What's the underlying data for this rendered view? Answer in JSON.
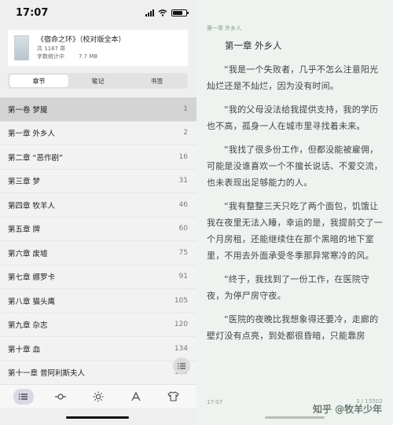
{
  "status_bar": {
    "time": "17:07"
  },
  "book": {
    "title": "《宿命之环》（校对版全本）",
    "chapters_count": "共 1187 章",
    "stats_label": "字数统计中",
    "file_size": "7.7 MB"
  },
  "tabs": [
    {
      "label": "章节",
      "active": true
    },
    {
      "label": "笔记",
      "active": false
    },
    {
      "label": "书签",
      "active": false
    }
  ],
  "chapters": [
    {
      "title": "第一卷 梦魇",
      "page": "1",
      "current": true
    },
    {
      "title": "第一章 外乡人",
      "page": "2"
    },
    {
      "title": "第二章 “恶作剧”",
      "page": "16"
    },
    {
      "title": "第三章 梦",
      "page": "31"
    },
    {
      "title": "第四章 牧羊人",
      "page": "46"
    },
    {
      "title": "第五章 牌",
      "page": "60"
    },
    {
      "title": "第六章 废墟",
      "page": "75"
    },
    {
      "title": "第七章 娜罗卡",
      "page": "91"
    },
    {
      "title": "第八章 猫头鹰",
      "page": "105"
    },
    {
      "title": "第九章 杂志",
      "page": "120"
    },
    {
      "title": "第十章 血",
      "page": "134"
    },
    {
      "title": "第十一章 普阿利斯夫人",
      "page": "149"
    }
  ],
  "toolbar": {
    "icons": [
      "list-icon",
      "slider-icon",
      "brightness-icon",
      "font-icon",
      "theme-shirt-icon"
    ]
  },
  "reader": {
    "header": "第一章 外乡人",
    "chapter_title": "第一章 外乡人",
    "paragraphs": [
      "“我是一个失败者，几乎不怎么注意阳光灿烂还是不灿烂，因为没有时间。",
      "“我的父母没法给我提供支持，我的学历也不高，孤身一人在城市里寻找着未来。",
      "“我找了很多份工作，但都没能被雇佣，可能是没谁喜欢一个不擅长说话、不爱交流，也未表现出足够能力的人。",
      "“我有整整三天只吃了两个面包，饥饿让我在夜里无法入睡，幸运的是，我提前交了一个月房租，还能继续住在那个黑暗的地下室里，不用去外面承受冬季那异常寒冷的风。",
      "“终于，我找到了一份工作，在医院守夜，为停尸房守夜。",
      "“医院的夜晚比我想象得还要冷，走廊的壁灯没有点亮，到处都很昏暗，只能靠房"
    ],
    "footer_time": "17:07",
    "page_indicator": "3 / 15502",
    "watermark": "知乎 @牧羊少年"
  }
}
